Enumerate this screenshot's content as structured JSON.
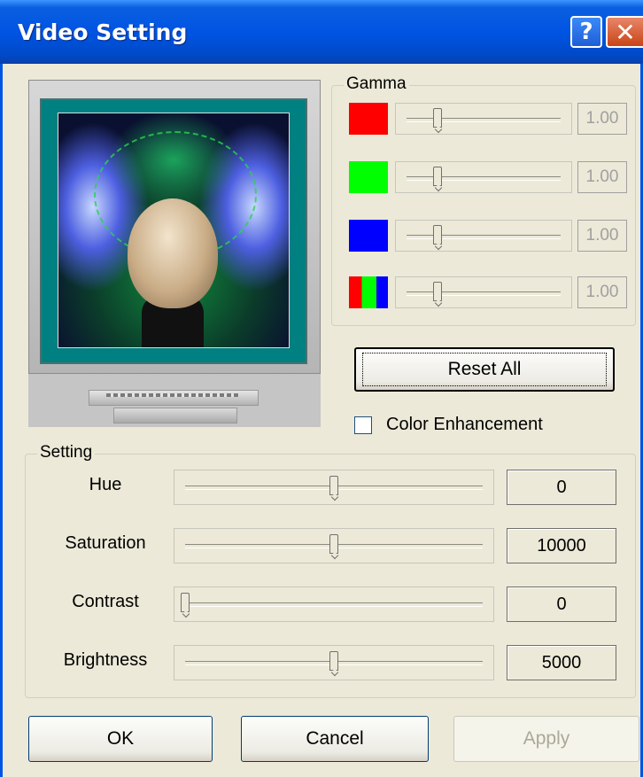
{
  "window": {
    "title": "Video Setting",
    "help_label": "?",
    "close_label": "✕"
  },
  "gamma": {
    "legend": "Gamma",
    "rows": [
      {
        "color": "#FF0000",
        "value": "1.00",
        "level": 0.2
      },
      {
        "color": "#00FF00",
        "value": "1.00",
        "level": 0.2
      },
      {
        "color": "#0000FF",
        "value": "1.00",
        "level": 0.2
      },
      {
        "color": "rgb",
        "value": "1.00",
        "level": 0.2
      }
    ]
  },
  "reset_all_label": "Reset All",
  "color_enhancement": {
    "label": "Color Enhancement",
    "checked": false
  },
  "setting": {
    "legend": "Setting",
    "rows": [
      {
        "label": "Hue",
        "value": "0",
        "level": 0.5
      },
      {
        "label": "Saturation",
        "value": "10000",
        "level": 0.5
      },
      {
        "label": "Contrast",
        "value": "0",
        "level": 0.0
      },
      {
        "label": "Brightness",
        "value": "5000",
        "level": 0.5
      }
    ]
  },
  "buttons": {
    "ok": "OK",
    "cancel": "Cancel",
    "apply": "Apply"
  }
}
